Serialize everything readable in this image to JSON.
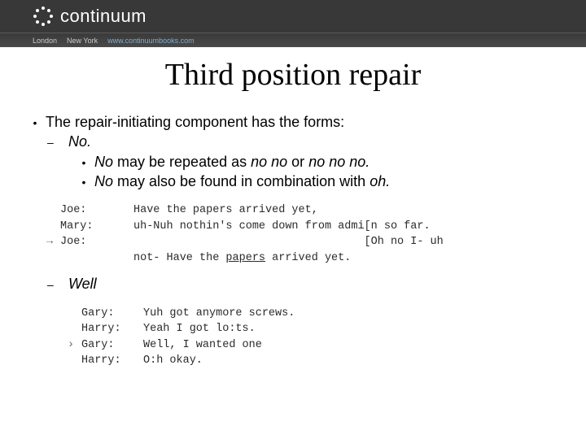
{
  "header": {
    "brand": "continuum",
    "sub_left": "London",
    "sub_mid": "New York",
    "sub_url": "www.continuumbooks.com"
  },
  "title": "Third position repair",
  "body": {
    "lead": "The repair-initiating component has the forms:",
    "no_label": "No.",
    "no_sub1_pre": "No",
    "no_sub1_mid": " may be repeated as ",
    "no_sub1_ital1": "no no",
    "no_sub1_or": " or ",
    "no_sub1_ital2": "no no no.",
    "no_sub2_pre": "No",
    "no_sub2_mid": " may also be found in combination with ",
    "no_sub2_ital": "oh.",
    "well_label": "Well"
  },
  "transcript1": {
    "r1_sp": "Joe:",
    "r1_txt": "Have the papers arrived yet,",
    "r2_sp": "Mary:",
    "r2_txt": "uh-Nuh nothin's come down from admi[n so far.",
    "r3_sp": "Joe:",
    "r3_txt_a": "                                   [Oh no I- uh",
    "r4_txt": "not- Have the ",
    "r4_ul": "papers",
    "r4_end": " arrived yet."
  },
  "transcript2": {
    "r1_sp": "Gary:",
    "r1_txt": "Yuh got anymore screws.",
    "r2_sp": "Harry:",
    "r2_txt": "Yeah I got lo:ts.",
    "r3_sp": "Gary:",
    "r3_txt": "Well, I wanted one",
    "r4_sp": "Harry:",
    "r4_txt": "O:h okay."
  }
}
